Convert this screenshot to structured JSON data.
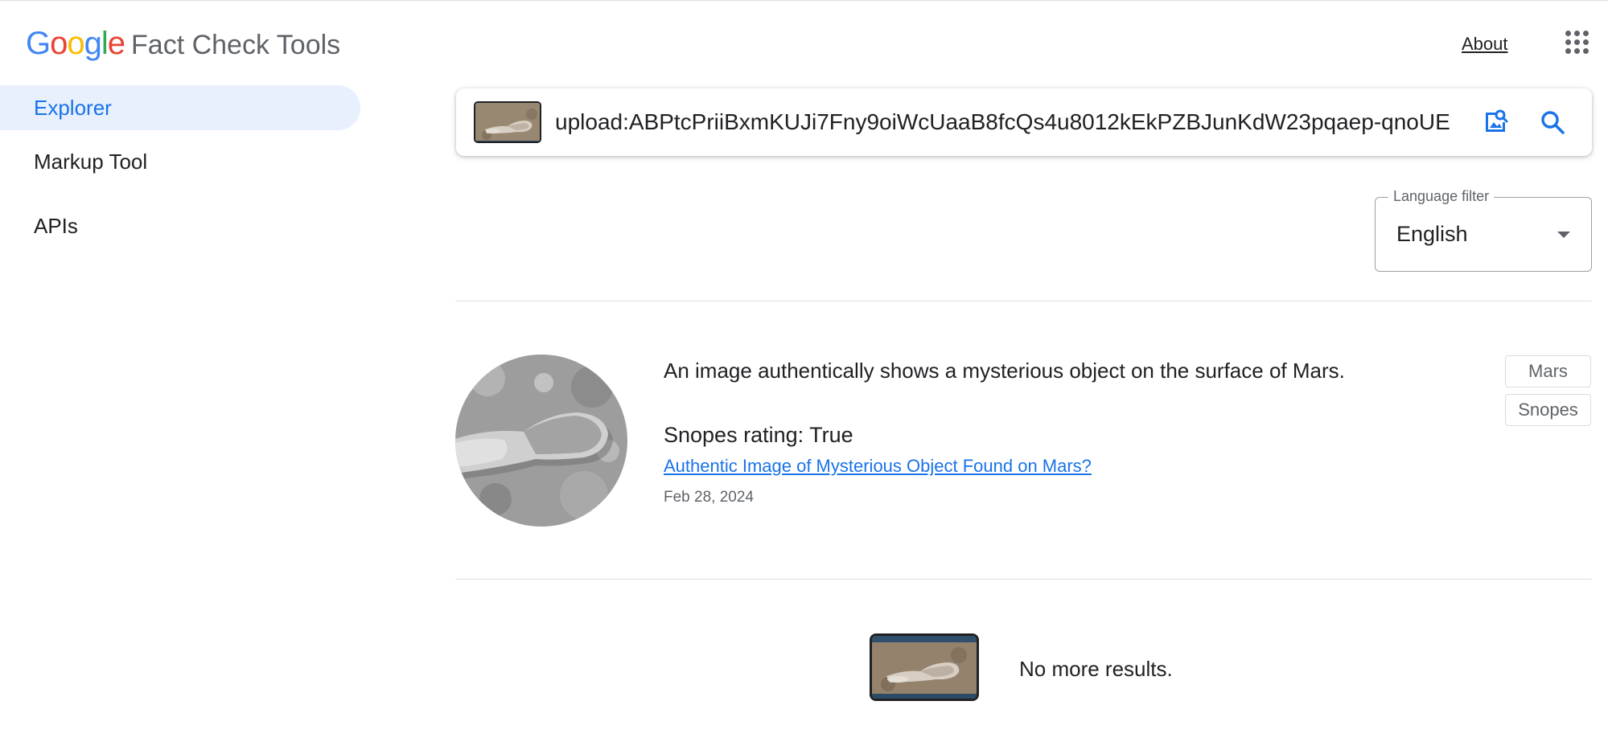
{
  "header": {
    "logo_letters": [
      {
        "ch": "G",
        "color": "#4285F4"
      },
      {
        "ch": "o",
        "color": "#EA4335"
      },
      {
        "ch": "o",
        "color": "#FBBC05"
      },
      {
        "ch": "g",
        "color": "#4285F4"
      },
      {
        "ch": "l",
        "color": "#34A853"
      },
      {
        "ch": "e",
        "color": "#EA4335"
      }
    ],
    "product_name": "Fact Check Tools",
    "about_label": "About",
    "apps_icon": "apps-grid-icon"
  },
  "sidebar": {
    "items": [
      {
        "label": "Explorer",
        "active": true
      },
      {
        "label": "Markup Tool",
        "active": false
      },
      {
        "label": "APIs",
        "active": false
      }
    ]
  },
  "search": {
    "query": "upload:ABPtcPriiBxmKUJi7Fny9oiWcUaaB8fcQs4u8012kEkPZBJunKdW23pqaep-qnoUE",
    "image_search_icon": "image-search-icon",
    "search_icon": "search-icon"
  },
  "language_filter": {
    "label": "Language filter",
    "value": "English"
  },
  "result": {
    "claim": "An image authentically shows a mysterious object on the surface of Mars.",
    "publisher": "Snopes",
    "rating_label": "rating:",
    "rating_value": "True",
    "article_title": "Authentic Image of Mysterious Object Found on Mars?",
    "date": "Feb 28, 2024",
    "tags": [
      "Mars",
      "Snopes"
    ]
  },
  "footer": {
    "no_more_results": "No more results."
  },
  "colors": {
    "accent": "#1a73e8",
    "active_nav_bg": "#e8f0fe"
  }
}
